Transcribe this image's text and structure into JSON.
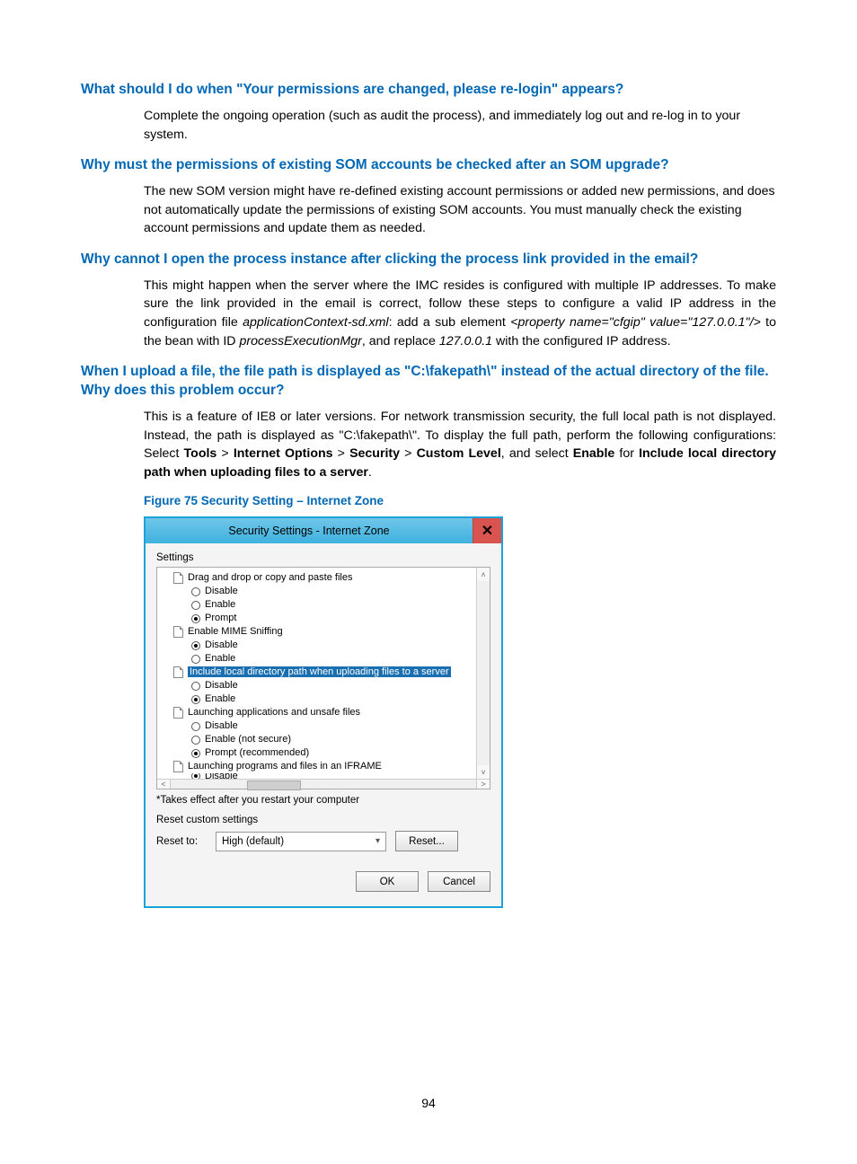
{
  "page_number": "94",
  "sections": [
    {
      "heading": "What should I do when \"Your permissions are changed, please re-login\" appears?",
      "paragraph": "Complete the ongoing operation (such as audit the process), and immediately log out and re-log in to your system."
    },
    {
      "heading": "Why must the permissions of existing SOM accounts be checked after an SOM upgrade?",
      "paragraph": "The new SOM version might have re-defined existing account permissions or added new permissions, and does not automatically update the permissions of existing SOM accounts. You must manually check the existing account permissions and update them as needed."
    },
    {
      "heading": "Why cannot I open the process instance after clicking the process link provided in the email?",
      "paragraph_html": "This might happen when the server where the IMC resides is configured with multiple IP addresses. To make sure the link provided in the email is correct, follow these steps to configure a valid IP address in the configuration file <em>applicationContext-sd.xml</em>: add a sub element <em>&lt;property name=\"cfgip\" value=\"127.0.0.1\"/&gt;</em> to the bean with ID <em>processExecutionMgr</em>, and replace <em>127.0.0.1</em> with the configured IP address."
    },
    {
      "heading": "When I upload a file, the file path is displayed as \"C:\\fakepath\\\" instead of the actual directory of the file. Why does this problem occur?",
      "paragraph_html": "This is a feature of IE8 or later versions. For network transmission security, the full local path is not displayed. Instead, the path is displayed as \"C:\\fakepath\\\". To display the full path, perform the following configurations: Select <b>Tools</b> &gt; <b>Internet Options</b> &gt; <b>Security</b> &gt; <b>Custom Level</b>, and select <b>Enable</b> for <b>Include local directory path when uploading files to a server</b>."
    }
  ],
  "figure_caption": "Figure 75 Security Setting – Internet Zone",
  "dialog": {
    "title": "Security Settings - Internet Zone",
    "settings_label": "Settings",
    "tree": [
      {
        "type": "node",
        "label": "Drag and drop or copy and paste files"
      },
      {
        "type": "opt",
        "label": "Disable",
        "selected": false
      },
      {
        "type": "opt",
        "label": "Enable",
        "selected": false
      },
      {
        "type": "opt",
        "label": "Prompt",
        "selected": true
      },
      {
        "type": "node",
        "label": "Enable MIME Sniffing"
      },
      {
        "type": "opt",
        "label": "Disable",
        "selected": true
      },
      {
        "type": "opt",
        "label": "Enable",
        "selected": false
      },
      {
        "type": "node",
        "label": "Include local directory path when uploading files to a server",
        "highlight": true
      },
      {
        "type": "opt",
        "label": "Disable",
        "selected": false
      },
      {
        "type": "opt",
        "label": "Enable",
        "selected": true
      },
      {
        "type": "node",
        "label": "Launching applications and unsafe files"
      },
      {
        "type": "opt",
        "label": "Disable",
        "selected": false
      },
      {
        "type": "opt",
        "label": "Enable (not secure)",
        "selected": false
      },
      {
        "type": "opt",
        "label": "Prompt (recommended)",
        "selected": true
      },
      {
        "type": "node",
        "label": "Launching programs and files in an IFRAME"
      },
      {
        "type": "opt",
        "label": "Disable",
        "selected": true,
        "cut": true
      }
    ],
    "note": "*Takes effect after you restart your computer",
    "reset_label": "Reset custom settings",
    "reset_to": "Reset to:",
    "combo_value": "High (default)",
    "reset_button": "Reset...",
    "ok": "OK",
    "cancel": "Cancel"
  }
}
